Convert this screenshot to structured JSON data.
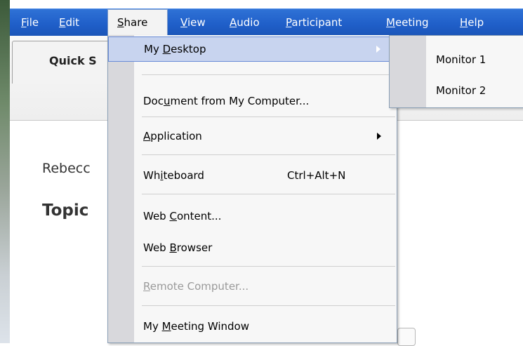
{
  "menubar": {
    "items": [
      {
        "label_u": "F",
        "label_rest": "ile"
      },
      {
        "label_u": "E",
        "label_rest": "dit"
      },
      {
        "label_u": "S",
        "label_rest": "hare"
      },
      {
        "label_u": "V",
        "label_rest": "iew"
      },
      {
        "label_u": "A",
        "label_rest": "udio"
      },
      {
        "label_u": "P",
        "label_rest": "articipant"
      },
      {
        "label_u": "M",
        "label_rest": "eeting"
      },
      {
        "label_u": "H",
        "label_rest": "elp"
      }
    ]
  },
  "background": {
    "tab_label": "Quick S",
    "text_line1": "Rebecc",
    "text_line2": "Topic"
  },
  "share_menu": {
    "items": [
      {
        "pre": "My ",
        "u": "D",
        "post": "esktop"
      },
      {
        "pre": "Doc",
        "u": "u",
        "post": "ment from My Computer..."
      },
      {
        "pre": "",
        "u": "A",
        "post": "pplication"
      },
      {
        "pre": "Wh",
        "u": "i",
        "post": "teboard",
        "shortcut": "Ctrl+Alt+N"
      },
      {
        "pre": "Web ",
        "u": "C",
        "post": "ontent..."
      },
      {
        "pre": "Web ",
        "u": "B",
        "post": "rowser"
      },
      {
        "pre": "",
        "u": "R",
        "post": "emote Computer..."
      },
      {
        "pre": "My ",
        "u": "M",
        "post": "eeting Window"
      }
    ]
  },
  "desktop_submenu": {
    "items": [
      "Monitor 1",
      "Monitor 2"
    ]
  },
  "colors": {
    "menubar": "#1f5ec8",
    "highlight": "#c8d4ef",
    "gutter": "#d8d8dc"
  }
}
